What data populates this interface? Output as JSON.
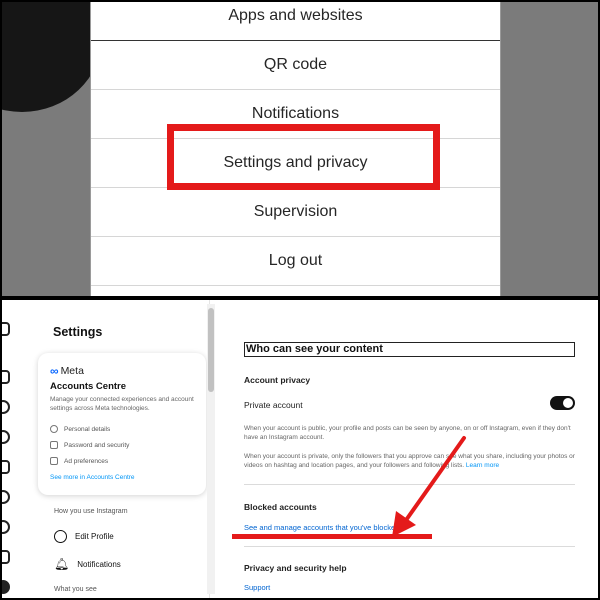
{
  "top_menu": {
    "items": [
      {
        "label": "Apps and websites"
      },
      {
        "label": "QR code"
      },
      {
        "label": "Notifications"
      },
      {
        "label": "Settings and privacy"
      },
      {
        "label": "Supervision"
      },
      {
        "label": "Log out"
      }
    ],
    "highlight_color": "#e41a1a"
  },
  "sidebar": {
    "title": "Settings",
    "accounts_centre": {
      "brand": "Meta",
      "title": "Accounts Centre",
      "description": "Manage your connected experiences and account settings across Meta technologies.",
      "items": [
        {
          "label": "Personal details",
          "icon": "person-icon"
        },
        {
          "label": "Password and security",
          "icon": "shield-icon"
        },
        {
          "label": "Ad preferences",
          "icon": "ad-icon"
        }
      ],
      "link": "See more in Accounts Centre"
    },
    "section_how": "How you use Instagram",
    "items": [
      {
        "label": "Edit Profile",
        "icon": "profile-icon"
      },
      {
        "label": "Notifications",
        "icon": "bell-icon"
      }
    ],
    "section_what": "What you see"
  },
  "content": {
    "title": "Who can see your content",
    "account_privacy": {
      "heading": "Account privacy",
      "row_label": "Private account",
      "toggle_on": true,
      "para1": "When your account is public, your profile and posts can be seen by anyone, on or off Instagram, even if they don't have an Instagram account.",
      "para2": "When your account is private, only the followers that you approve can see what you share, including your photos or videos on hashtag and location pages, and your followers and following lists.",
      "learn_more": "Learn more"
    },
    "blocked": {
      "heading": "Blocked accounts",
      "link": "See and manage accounts that you've blocked"
    },
    "help": {
      "heading": "Privacy and security help",
      "link": "Support"
    }
  },
  "colors": {
    "accent_red": "#e41a1a",
    "link_blue": "#0064d1",
    "meta_blue": "#0866ff"
  }
}
